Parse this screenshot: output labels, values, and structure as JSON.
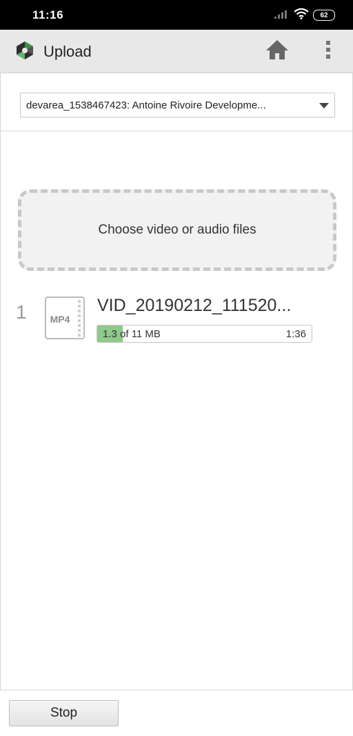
{
  "status_bar": {
    "time": "11:16",
    "battery": "62",
    "icons": [
      "signal-icon",
      "wifi-icon",
      "battery-icon"
    ]
  },
  "toolbar": {
    "title": "Upload",
    "icons": [
      "app-logo-icon",
      "home-icon",
      "overflow-menu-icon"
    ]
  },
  "channel_select": {
    "value": "devarea_1538467423: Antoine Rivoire Developme..."
  },
  "dropzone": {
    "label": "Choose video or audio files"
  },
  "uploads": [
    {
      "index": "1",
      "file_type": "MP4",
      "file_name": "VID_20190212_111520...",
      "progress_text": "1.3 of 11 MB",
      "progress_fraction": 0.118,
      "time_remaining": "1:36"
    }
  ],
  "footer": {
    "stop_label": "Stop"
  },
  "colors": {
    "status_bar": "#000000",
    "toolbar": "#e8e8e8",
    "dropzone_bg": "#f2f2f2",
    "dropzone_border": "#c8c8c8",
    "progress_fill": "#8fc98b",
    "home_icon": "#666666"
  }
}
